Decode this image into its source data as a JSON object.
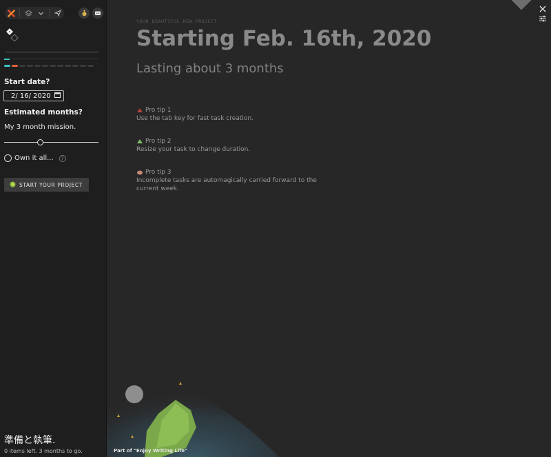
{
  "toolbar": {
    "icons": [
      "x-logo-icon",
      "layers-icon",
      "chevron-down-icon",
      "send-icon",
      "coin-bag-icon",
      "chat-icon"
    ]
  },
  "sidebar": {
    "title_input": {
      "value": "",
      "placeholder": ""
    },
    "start_date_label": "Start date?",
    "start_date_value": "2/ 16/ 2020",
    "estimated_months_label": "Estimated months?",
    "mission_text": "My 3 month mission.",
    "months_slider": {
      "value": 3,
      "fraction": 0.38
    },
    "own_it_label": "Own it all...",
    "help_glyph": "?",
    "start_button_label": "START YOUR PROJECT",
    "footer_kanji": "準備と執筆.",
    "footer_status": "0 items left. 3 months to go."
  },
  "main": {
    "kicker": "YOUR BEAUTIFUL NEW PROJECT",
    "title": "Starting Feb. 16th, 2020",
    "subtitle": "Lasting about 3 months",
    "tips": [
      {
        "title": "Pro tip 1",
        "text": "Use the tab key for fast task creation.",
        "icon": "red-mountain-icon",
        "color": "#b4453d"
      },
      {
        "title": "Pro tip 2",
        "text": "Resize your task to change duration.",
        "icon": "green-mountain-icon",
        "color": "#7fbf6a"
      },
      {
        "title": "Pro tip 3",
        "text": "Incomplete tasks are automagically carried forward to the current week.",
        "icon": "brown-stone-icon",
        "color": "#c58a76"
      }
    ],
    "part_of": "Part of \"Enjoy Writing Life\""
  },
  "colors": {
    "sidebar_bg": "#1f1e1e",
    "main_bg": "#282727",
    "accent_teal": "#3fc3c0",
    "accent_orange": "#e0603d",
    "logo_orange": "#e8492b"
  }
}
